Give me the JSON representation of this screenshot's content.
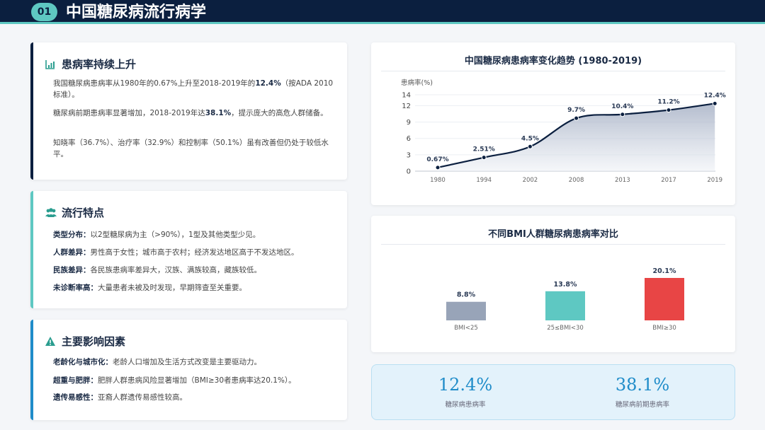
{
  "header": {
    "badge": "01",
    "title": "中国糖尿病流行病学"
  },
  "card1": {
    "title": "患病率持续上升",
    "p1_pre": "我国糖尿病患病率从1980年的0.67%上升至2018-2019年的",
    "p1_bold": "12.4%",
    "p1_post": "（按ADA 2010标准）。",
    "p2_pre": "糖尿病前期患病率显著增加，2018-2019年达",
    "p2_bold": "38.1%",
    "p2_post": "，提示庞大的高危人群储备。",
    "p3": "知晓率（36.7%）、治疗率（32.9%）和控制率（50.1%）虽有改善但仍处于较低水平。"
  },
  "card2": {
    "title": "流行特点",
    "rows": [
      {
        "label": "类型分布：",
        "text": "以2型糖尿病为主（>90%），1型及其他类型少见。"
      },
      {
        "label": "人群差异：",
        "text": "男性高于女性；城市高于农村；经济发达地区高于不发达地区。"
      },
      {
        "label": "民族差异：",
        "text": "各民族患病率差异大，汉族、满族较高，藏族较低。"
      },
      {
        "label": "未诊断率高：",
        "text": "大量患者未被及时发现，早期筛查至关重要。"
      }
    ]
  },
  "card3": {
    "title": "主要影响因素",
    "rows": [
      {
        "label": "老龄化与城市化：",
        "text": "老龄人口增加及生活方式改变是主要驱动力。"
      },
      {
        "label": "超重与肥胖：",
        "text": "肥胖人群患病风险显著增加（BMI≥30者患病率达20.1%）。"
      },
      {
        "label": "遗传易感性：",
        "text": "亚裔人群遗传易感性较高。"
      }
    ]
  },
  "colors": {
    "navy": "#0b1f3f",
    "teal": "#5ec8c2",
    "blue": "#1f8cc9",
    "slate": "#98a4b8",
    "red": "#e84545"
  },
  "chart_data": [
    {
      "type": "area",
      "title": "中国糖尿病患病率变化趋势 (1980-2019)",
      "ylabel": "患病率(%)",
      "categories": [
        "1980",
        "1994",
        "2002",
        "2008",
        "2013",
        "2017",
        "2019"
      ],
      "values": [
        0.67,
        2.51,
        4.5,
        9.7,
        10.4,
        11.2,
        12.4
      ],
      "labels": [
        "0.67%",
        "2.51%",
        "4.5%",
        "9.7%",
        "10.4%",
        "11.2%",
        "12.4%"
      ],
      "yticks": [
        0,
        3,
        6,
        9,
        12,
        14
      ],
      "ylim": [
        0,
        14
      ],
      "grid": true
    },
    {
      "type": "bar",
      "title": "不同BMI人群糖尿病患病率对比",
      "categories": [
        "BMI<25",
        "25≤BMI<30",
        "BMI≥30"
      ],
      "values": [
        8.8,
        13.8,
        20.1
      ],
      "labels": [
        "8.8%",
        "13.8%",
        "20.1%"
      ],
      "colors": [
        "#98a4b8",
        "#5ec8c2",
        "#e84545"
      ],
      "ylim": [
        0,
        20.1
      ]
    }
  ],
  "stats": [
    {
      "value": "12.4%",
      "label": "糖尿病患病率"
    },
    {
      "value": "38.1%",
      "label": "糖尿病前期患病率"
    }
  ]
}
